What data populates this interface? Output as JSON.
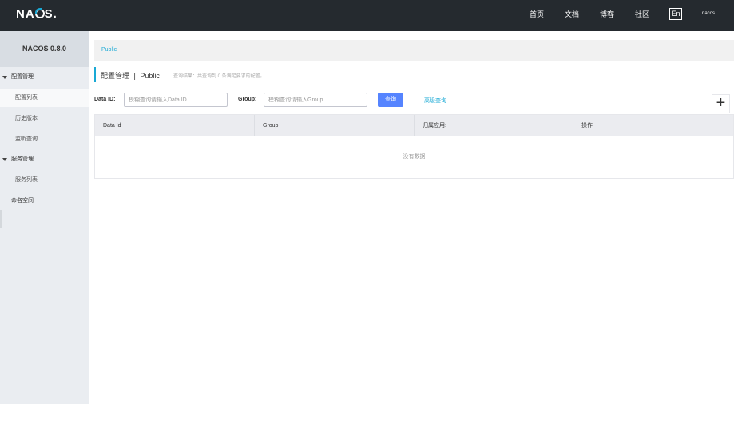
{
  "header": {
    "logo": "NACOS.",
    "nav": [
      "首页",
      "文档",
      "博客",
      "社区"
    ],
    "lang": "En",
    "user": "nacos"
  },
  "sidebar": {
    "title": "NACOS 0.8.0",
    "groups": [
      {
        "label": "配置管理",
        "items": [
          "配置列表",
          "历史版本",
          "监听查询"
        ]
      },
      {
        "label": "服务管理",
        "items": [
          "服务列表"
        ]
      }
    ],
    "namespace": "命名空间"
  },
  "breadcrumb": "Public",
  "page": {
    "title": "配置管理",
    "separator": "|",
    "namespace": "Public",
    "result": "查询结果：共查询到 0 条满足要求的配置。"
  },
  "search": {
    "dataid_label": "Data ID:",
    "dataid_placeholder": "模糊查询请输入Data ID",
    "group_label": "Group:",
    "group_placeholder": "模糊查询请输入Group",
    "query_button": "查询",
    "advanced_link": "高级查询",
    "add_button": "+"
  },
  "table": {
    "columns": [
      "Data Id",
      "Group",
      "归属应用:",
      "操作"
    ],
    "rows": [],
    "empty_text": "没有数据"
  }
}
